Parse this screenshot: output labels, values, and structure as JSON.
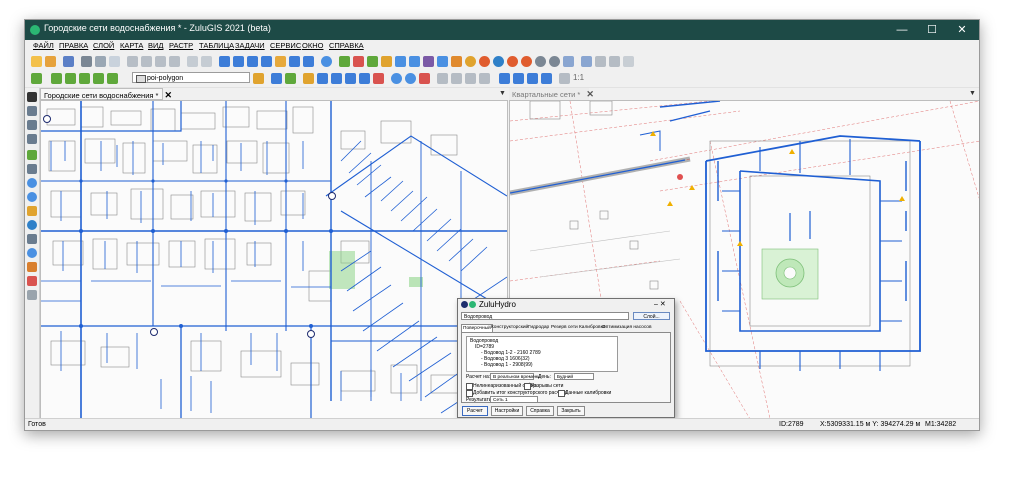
{
  "window": {
    "title": "Городские сети водоснабжения * - ZuluGIS 2021 (beta)"
  },
  "window_controls": {
    "minimize": "—",
    "maximize": "☐",
    "close": "✕"
  },
  "menu": [
    "ФАЙЛ",
    "ПРАВКА",
    "СЛОЙ",
    "КАРТА",
    "ВИД",
    "РАСТР",
    "ТАБЛИЦА",
    "ЗАДАЧИ",
    "СЕРВИС",
    "ОКНО",
    "СПРАВКА"
  ],
  "toolbar": {
    "layer_select": "poi-polygon",
    "scale_text": "1:1"
  },
  "panes": {
    "left_tab": "Городские сети водоснабжения *",
    "right_tab": "Квартальные сети *",
    "close_symbol": "✕",
    "menu_arrow": "▼"
  },
  "status": {
    "left": "Готов",
    "id": "ID:2789",
    "coords": "X:5309331.15 м  Y: 394274.29 м",
    "scale": "M1:34282"
  },
  "dialog": {
    "title": "ZuluHydro",
    "field": "Водопровод",
    "dropdown_btn": "Слой...",
    "tabs": [
      "Поверочный",
      "Конструкторский",
      "Гидродар",
      "Резерв сети",
      "Калибровка",
      "Оптимизация насосов"
    ],
    "tree": [
      "Водопровод",
      "ID=2789",
      "- Водовод 1-2 - 2160 2789",
      "- Водовод 3 1606(32)",
      "- Водовод 1 - 2908(99)"
    ],
    "calc_label": "Расчет на:",
    "calc_value": "В реальном времени",
    "day_label": "День:",
    "day_value": "Будний",
    "opts": [
      "Нелинеаризованный отбор",
      "Разрывы сети",
      "Добавить итог конструкторского расчета",
      "Данные калибровки"
    ],
    "result_label": "Результаты:",
    "result_value": "Сеть 1",
    "buttons": [
      "Расчет",
      "Настройки",
      "Справка",
      "Закрыть"
    ],
    "title_controls": "– ✕"
  },
  "colors": {
    "titlebar": "#1d4a46",
    "pipe": "#1f5fd3",
    "building": "#8a8a8a",
    "park": "#8fd58a"
  }
}
